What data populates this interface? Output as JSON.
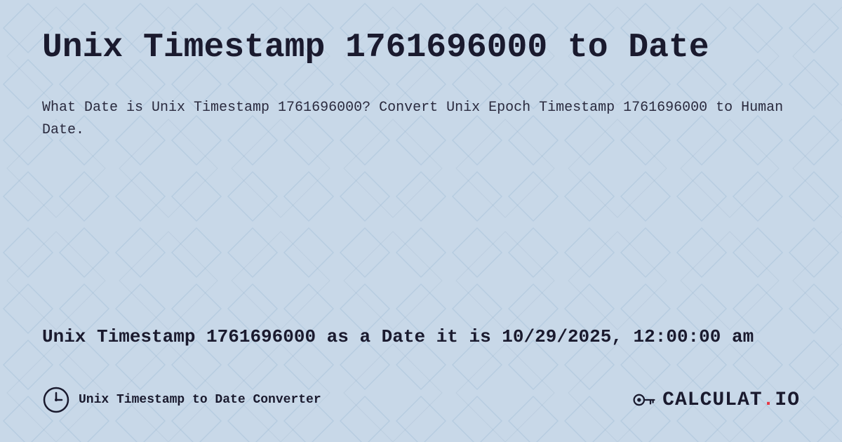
{
  "page": {
    "background_color": "#c8d8e8",
    "title": "Unix Timestamp 1761696000 to Date",
    "description": "What Date is Unix Timestamp 1761696000? Convert Unix Epoch Timestamp 1761696000 to Human Date.",
    "result": "Unix Timestamp 1761696000 as a Date it is 10/29/2025, 12:00:00 am",
    "footer": {
      "link_text": "Unix Timestamp to Date Converter",
      "logo_text": "CALCULAT.IO"
    }
  }
}
